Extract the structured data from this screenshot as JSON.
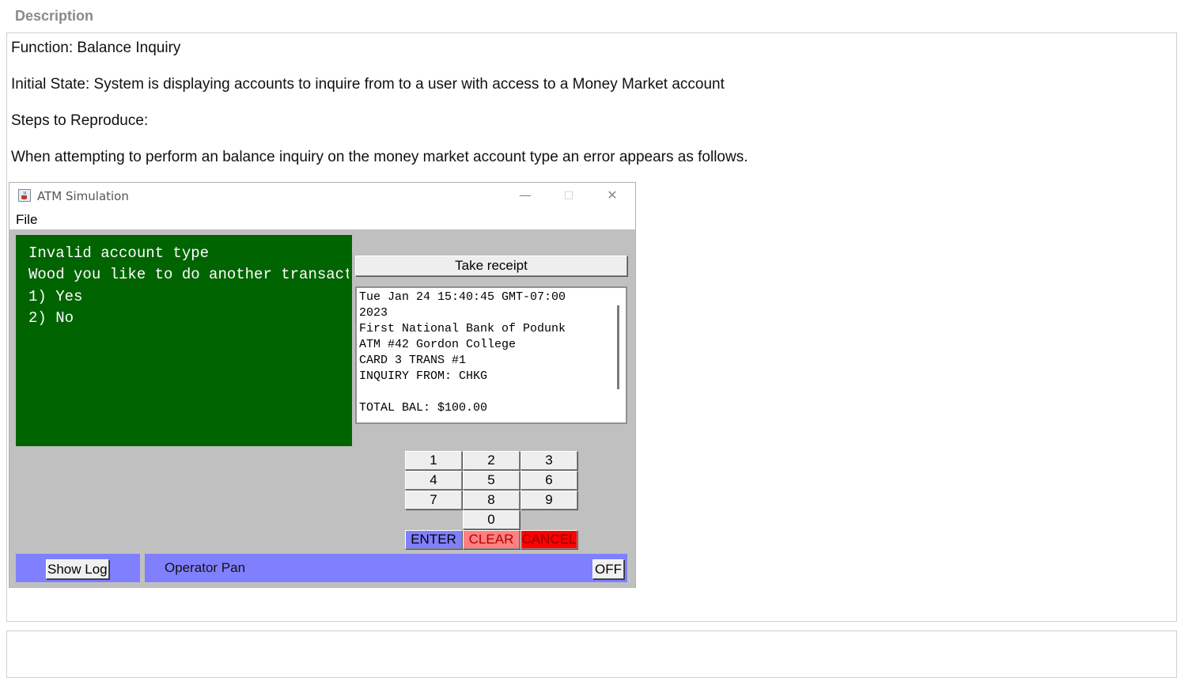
{
  "section": {
    "title": "Description"
  },
  "description": {
    "function": "Function: Balance Inquiry",
    "initial_state": "Initial State: System is displaying accounts to inquire from to a user with access to a Money Market account",
    "steps_label": "Steps to Reproduce:",
    "steps_text": "When attempting to perform an balance inquiry on the money market account type an error appears as follows."
  },
  "atm_window": {
    "title": "ATM Simulation",
    "controls": {
      "minimize": "—",
      "maximize": "□",
      "close": "✕"
    },
    "menu": {
      "file": "File"
    },
    "screen_lines": [
      "Invalid account type",
      "Wood you like to do another transaction?",
      "1) Yes",
      "2) No"
    ],
    "receipt_button": "Take receipt",
    "receipt_lines": [
      "Tue Jan 24 15:40:45 GMT-07:00",
      "2023",
      "First National Bank of Podunk",
      "ATM #42 Gordon College",
      "CARD 3 TRANS #1",
      "INQUIRY FROM: CHKG",
      "",
      "TOTAL BAL: $100.00"
    ],
    "keypad": {
      "digits": [
        "1",
        "2",
        "3",
        "4",
        "5",
        "6",
        "7",
        "8",
        "9",
        "0"
      ],
      "enter": "ENTER",
      "clear": "CLEAR",
      "cancel": "CANCEL"
    },
    "operator_panel": {
      "show_log": "Show Log",
      "label": "Operator Pan",
      "off": "OFF"
    },
    "colors": {
      "screen_bg": "#006400",
      "panel_bg": "#c0c0c0",
      "operator_bg": "#8080ff",
      "enter_bg": "#8080ff",
      "clear_bg": "#ff8080",
      "cancel_bg": "#ff0000"
    },
    "icons": {
      "app": "java-cup-icon"
    }
  }
}
